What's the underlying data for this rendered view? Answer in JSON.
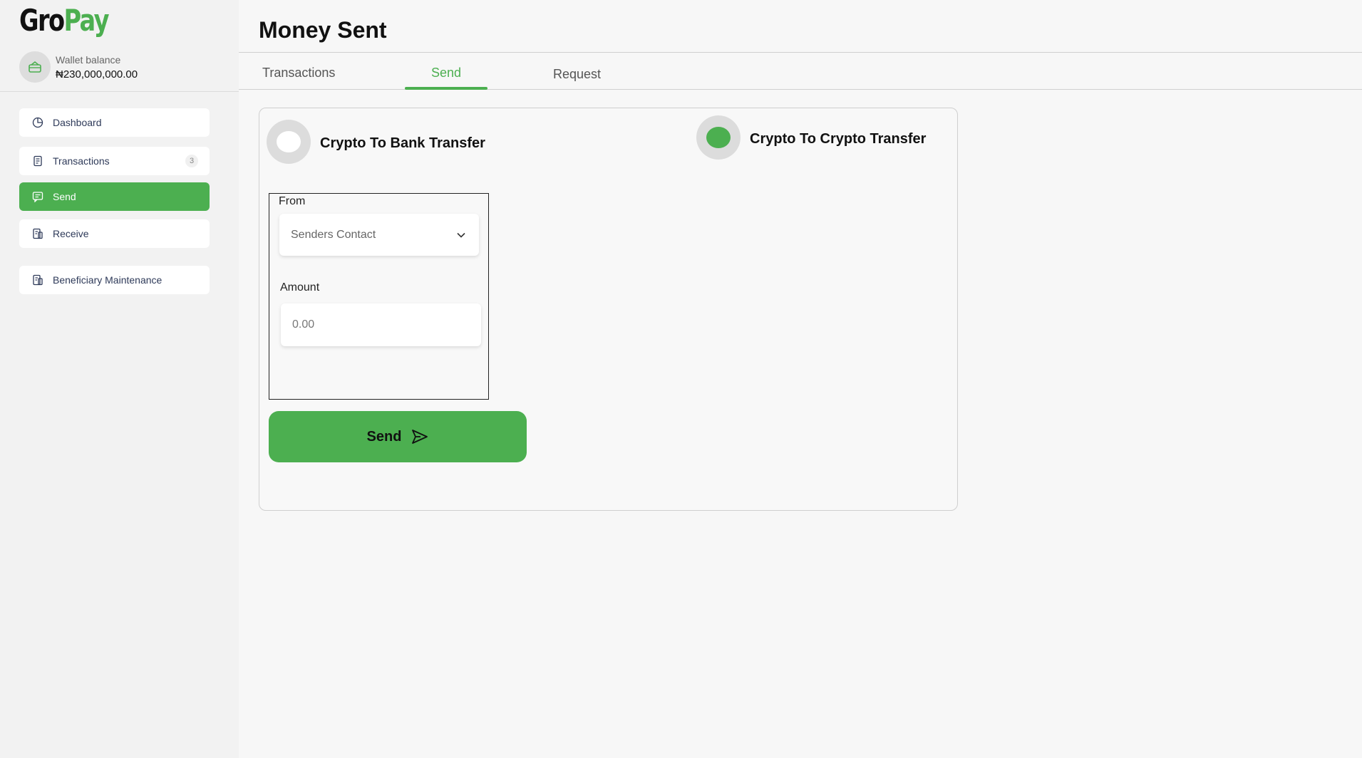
{
  "brand": {
    "part1": "Gro",
    "part2": "Pay"
  },
  "wallet": {
    "label": "Wallet balance",
    "amount": "₦230,000,000.00",
    "icon": "wallet-icon"
  },
  "sidebar": {
    "items": [
      {
        "label": "Dashboard",
        "icon": "pie-chart-icon"
      },
      {
        "label": "Transactions",
        "icon": "receipt-icon",
        "badge": "3"
      },
      {
        "label": "Send",
        "icon": "message-icon",
        "active": true
      },
      {
        "label": "Receive",
        "icon": "document-icon"
      },
      {
        "label": "Beneficiary Maintenance",
        "icon": "document-icon"
      }
    ]
  },
  "header": {
    "title": "Money Sent"
  },
  "tabs": [
    {
      "label": "Transactions"
    },
    {
      "label": "Send",
      "active": true
    },
    {
      "label": "Request"
    }
  ],
  "transfer_type": {
    "option1": {
      "label": "Crypto To Bank Transfer",
      "selected": false
    },
    "option2": {
      "label": "Crypto To Crypto Transfer",
      "selected": true
    }
  },
  "form": {
    "from_label": "From",
    "from_value": "Senders Contact",
    "amount_label": "Amount",
    "amount_placeholder": "0.00"
  },
  "actions": {
    "send_label": "Send"
  },
  "colors": {
    "accent": "#4caf50",
    "text": "#111111",
    "nav_text": "#2e3a59"
  }
}
